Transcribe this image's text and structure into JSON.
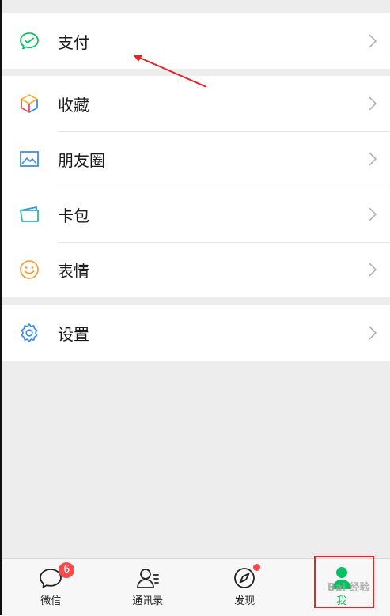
{
  "groups": [
    [
      {
        "label": "支付",
        "icon": "payment-icon"
      }
    ],
    [
      {
        "label": "收藏",
        "icon": "favorites-icon"
      },
      {
        "label": "朋友圈",
        "icon": "moments-icon"
      },
      {
        "label": "卡包",
        "icon": "card-wallet-icon"
      },
      {
        "label": "表情",
        "icon": "sticker-icon"
      }
    ],
    [
      {
        "label": "设置",
        "icon": "settings-icon"
      }
    ]
  ],
  "tabbar": {
    "tabs": [
      {
        "label": "微信",
        "icon": "chat-icon",
        "badge": "6"
      },
      {
        "label": "通讯录",
        "icon": "contacts-icon"
      },
      {
        "label": "发现",
        "icon": "discover-icon",
        "dot": true
      },
      {
        "label": "我",
        "icon": "me-icon",
        "active": true
      }
    ]
  },
  "watermark": "Bai 经验",
  "colors": {
    "accent": "#07c160",
    "badge": "#f54b4b",
    "annotation": "#e3262a"
  }
}
